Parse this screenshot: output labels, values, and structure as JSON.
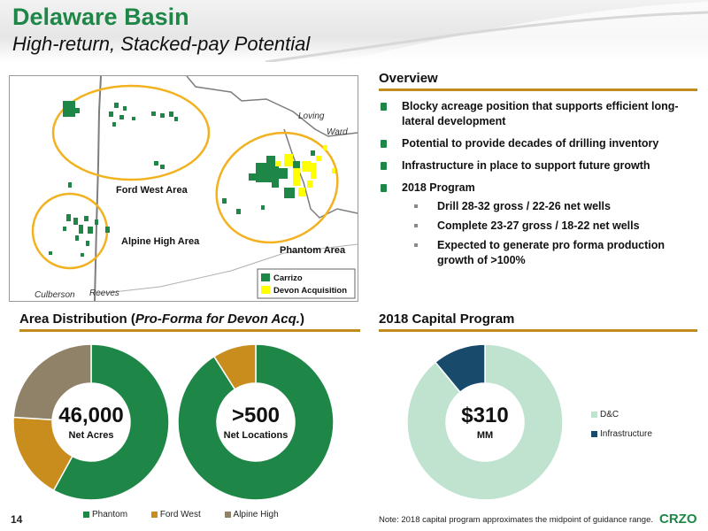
{
  "header": {
    "title": "Delaware Basin",
    "subtitle": "High-return, Stacked-pay Potential"
  },
  "map": {
    "labels": {
      "loving": "Loving",
      "ward": "Ward",
      "culberson": "Culberson",
      "reeves": "Reeves",
      "ford_west": "Ford West Area",
      "alpine_high": "Alpine High Area",
      "phantom": "Phantom Area"
    },
    "legend": {
      "carrizo": "Carrizo",
      "devon": "Devon Acquisition"
    },
    "colors": {
      "carrizo": "#1e8747",
      "devon": "#ffff00",
      "ellipse": "#f2b21f"
    }
  },
  "overview": {
    "title": "Overview",
    "bullets": [
      "Blocky acreage position that supports efficient long-lateral development",
      "Potential to provide decades of drilling inventory",
      "Infrastructure in place to support future growth",
      "2018 Program"
    ],
    "sub_bullets": [
      "Drill 28-32 gross / 22-26 net wells",
      "Complete 23-27 gross / 18-22 net wells",
      "Expected to generate pro forma production growth of >100%"
    ]
  },
  "area_distribution": {
    "title_prefix": "Area Distribution (",
    "title_italic": "Pro-Forma for Devon Acq.",
    "title_suffix": ")",
    "acres_value": "46,000",
    "acres_label": "Net Acres",
    "locations_value": ">500",
    "locations_label": "Net Locations"
  },
  "capital_program": {
    "title": "2018 Capital Program",
    "value": "$310",
    "unit": "MM"
  },
  "chart_data": [
    {
      "type": "pie",
      "categories": [
        "Phantom",
        "Ford West",
        "Alpine High"
      ],
      "values": [
        58,
        18,
        24
      ],
      "colors": [
        "#1e8747",
        "#c98d1e",
        "#8f8268"
      ],
      "legend": "bottom"
    },
    {
      "type": "pie",
      "categories": [
        "Phantom",
        "Ford West",
        "Alpine High"
      ],
      "values": [
        91,
        9,
        0
      ],
      "colors": [
        "#1e8747",
        "#c98d1e",
        "#8f8268"
      ],
      "legend": "bottom"
    },
    {
      "type": "pie",
      "categories": [
        "D&C",
        "Infrastructure"
      ],
      "values": [
        89,
        11
      ],
      "colors": [
        "#bfe3cf",
        "#174a6b"
      ],
      "legend": "right"
    }
  ],
  "legend_area": [
    "Phantom",
    "Ford West",
    "Alpine High"
  ],
  "legend_capital": [
    "D&C",
    "Infrastructure"
  ],
  "footer": {
    "page_number": "14",
    "note": "Note: 2018 capital program approximates the midpoint of guidance range.",
    "logo": "CRZO"
  }
}
